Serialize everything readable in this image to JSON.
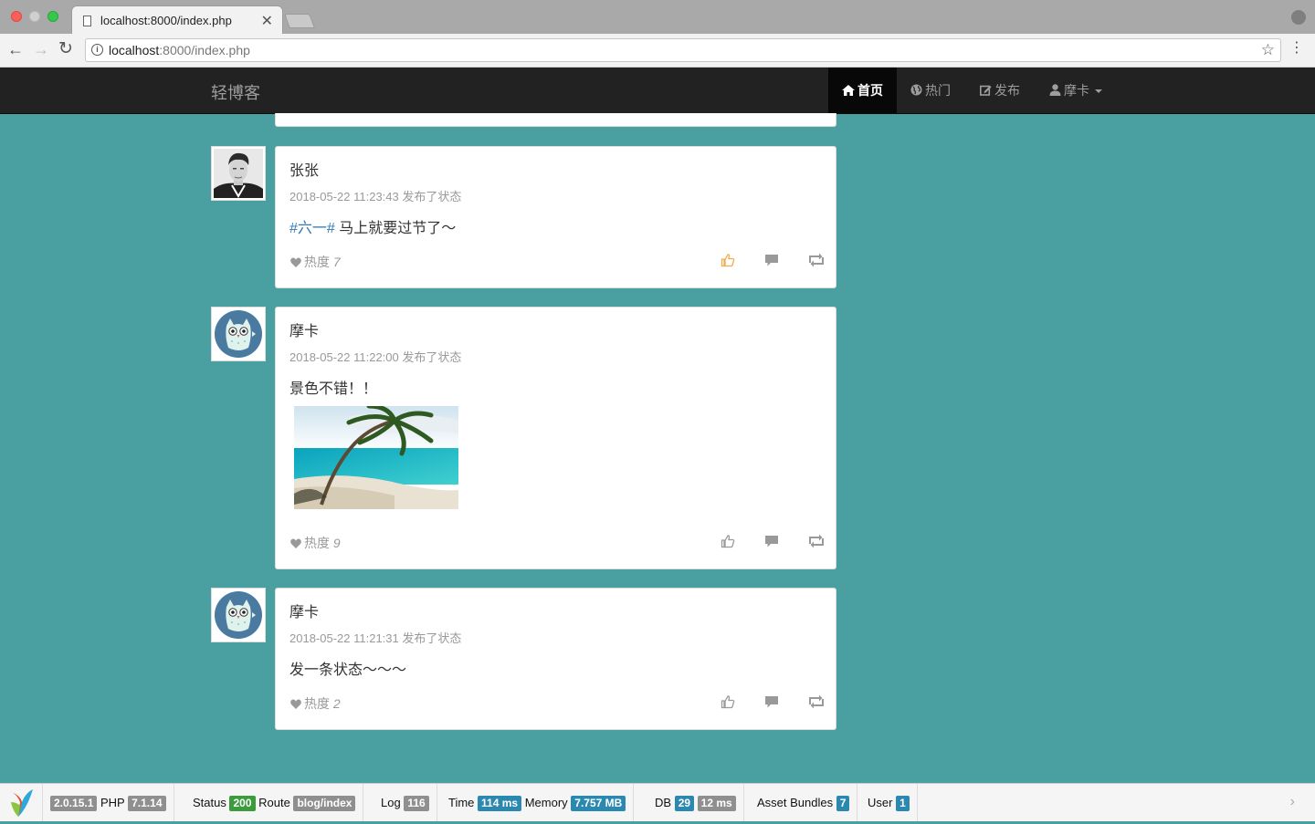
{
  "browser": {
    "tab_title": "localhost:8000/index.php",
    "tab_close": "✕",
    "url_host": "localhost",
    "url_path": ":8000/index.php"
  },
  "navbar": {
    "brand": "轻博客",
    "items": [
      {
        "label": "首页",
        "icon": "home-icon",
        "active": true
      },
      {
        "label": "热门",
        "icon": "globe-icon",
        "active": false
      },
      {
        "label": "发布",
        "icon": "edit-icon",
        "active": false
      },
      {
        "label": "摩卡",
        "icon": "user-icon",
        "active": false
      }
    ]
  },
  "posts": [
    {
      "author": "张张",
      "meta": "2018-05-22 11:23:43 发布了状态",
      "hashtag": "#六一#",
      "text": " 马上就要过节了～",
      "heat_label": "热度",
      "heat_value": "7",
      "liked": true,
      "has_image": false
    },
    {
      "author": "摩卡",
      "meta": "2018-05-22 11:22:00 发布了状态",
      "hashtag": "",
      "text": "景色不错！！",
      "heat_label": "热度",
      "heat_value": "9",
      "liked": false,
      "has_image": true
    },
    {
      "author": "摩卡",
      "meta": "2018-05-22 11:21:31 发布了状态",
      "hashtag": "",
      "text": "发一条状态～～～",
      "heat_label": "热度",
      "heat_value": "2",
      "liked": false,
      "has_image": false
    }
  ],
  "debug": {
    "yii_version": "2.0.15.1",
    "php_label": "PHP",
    "php_version": "7.1.14",
    "status_label": "Status",
    "status_value": "200",
    "route_label": "Route",
    "route_value": "blog/index",
    "log_label": "Log",
    "log_value": "116",
    "time_label": "Time",
    "time_value": "114 ms",
    "memory_label": "Memory",
    "memory_value": "7.757 MB",
    "db_label": "DB",
    "db_count": "29",
    "db_time": "12 ms",
    "assets_label": "Asset Bundles",
    "assets_value": "7",
    "user_label": "User",
    "user_value": "1"
  },
  "colors": {
    "page_bg": "#4aa0a0",
    "navbar_bg": "#222222",
    "like_active": "#f0ad4e",
    "link": "#337ab7"
  }
}
